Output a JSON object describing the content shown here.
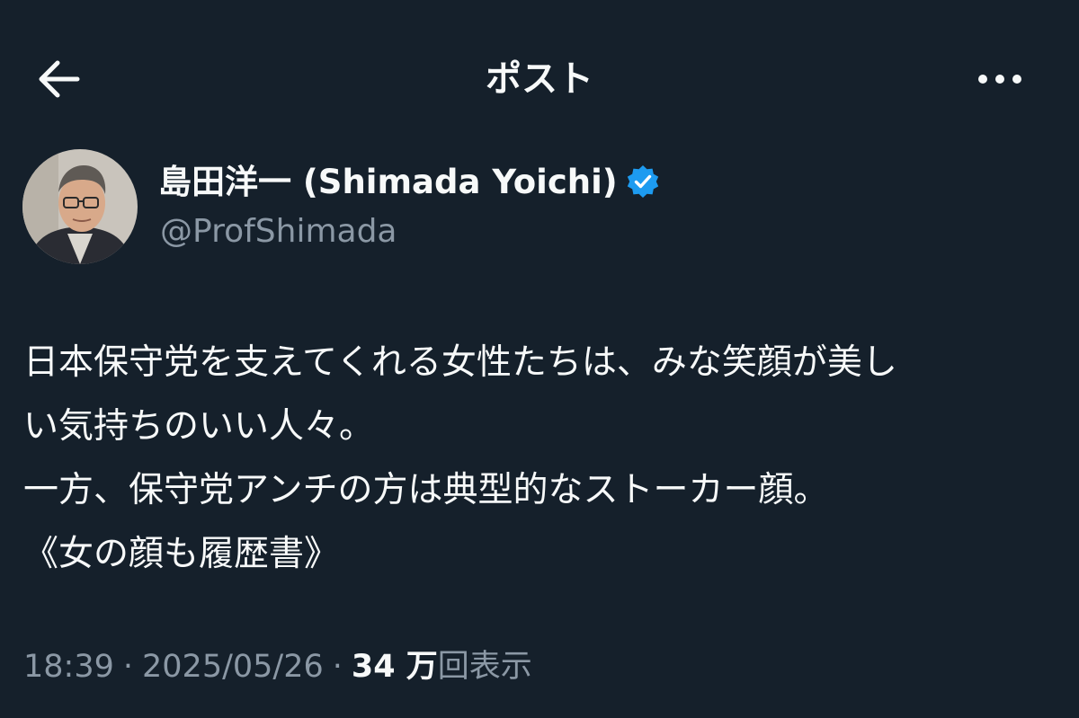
{
  "header": {
    "title": "ポスト",
    "back_icon": "arrow-left-icon",
    "more_icon": "more-horizontal-icon"
  },
  "author": {
    "name": "島田洋一 (Shimada Yoichi)",
    "handle": "@ProfShimada",
    "verified_icon": "verified-badge-icon",
    "verified_color": "#1d9bf0"
  },
  "post": {
    "lines": [
      "日本保守党を支えてくれる女性たちは、みな笑顔が美し",
      "い気持ちのいい人々。",
      "一方、保守党アンチの方は典型的なストーカー顔。",
      "《女の顔も履歴書》"
    ]
  },
  "meta": {
    "time": "18:39",
    "separator": "·",
    "date": "2025/05/26",
    "views_count": "34 万",
    "views_label": "回表示"
  },
  "colors": {
    "background": "#15202b",
    "text_primary": "#f7f9f9",
    "text_secondary": "#8b98a5",
    "accent": "#1d9bf0"
  }
}
